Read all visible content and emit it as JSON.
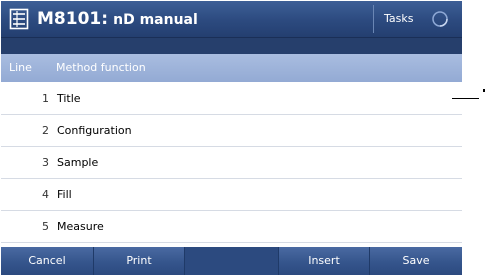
{
  "header": {
    "method_id": "M8101:",
    "method_name": "nD manual",
    "tasks_label": "Tasks",
    "method_icon": "method-list-icon",
    "busy_icon": "busy-spinner-icon"
  },
  "table": {
    "columns": {
      "line": "Line",
      "function": "Method function"
    },
    "rows": [
      {
        "num": "1",
        "label": "Title"
      },
      {
        "num": "2",
        "label": "Configuration"
      },
      {
        "num": "3",
        "label": "Sample"
      },
      {
        "num": "4",
        "label": "Fill"
      },
      {
        "num": "5",
        "label": "Measure"
      }
    ]
  },
  "actions": {
    "cancel": "Cancel",
    "print": "Print",
    "insert": "Insert",
    "save": "Save"
  },
  "colors": {
    "titlebar": "#2c4a7f",
    "column_header": "#9db2da",
    "row_divider": "#d6dbe4"
  }
}
